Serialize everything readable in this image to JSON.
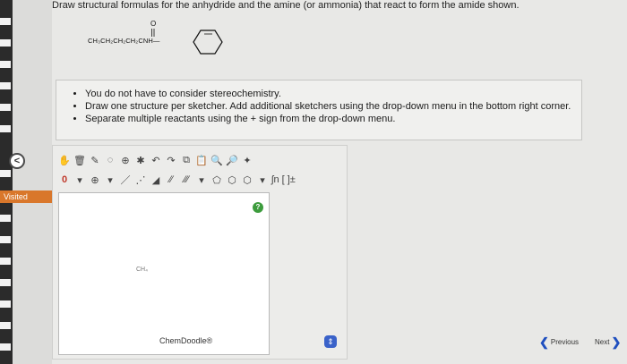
{
  "question": "Draw structural formulas for the anhydride and the amine (or ammonia) that react to form the amide shown.",
  "molecule": {
    "formula": "CH₃CH₂CH₂CH₂CNH—"
  },
  "instructions": [
    "You do not have to consider stereochemistry.",
    "Draw one structure per sketcher. Add additional sketchers using the drop-down menu in the bottom right corner.",
    "Separate multiple reactants using the + sign from the drop-down menu."
  ],
  "sidebar": {
    "visited_label": "Visited"
  },
  "sketcher": {
    "help": "?",
    "canvas_text": "CH₄",
    "brand": "ChemDoodle®",
    "charge": "0",
    "plus": "⊕",
    "func_label": "ʃn [ ]±"
  },
  "nav": {
    "previous": "Previous",
    "next": "Next"
  },
  "colors": {
    "accent": "#3a62c9",
    "visited": "#d9772b",
    "help": "#3d9c3d"
  }
}
